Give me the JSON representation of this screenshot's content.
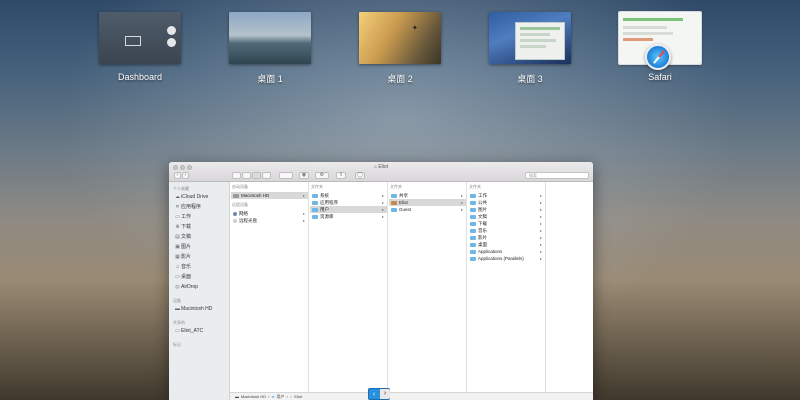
{
  "spaces": [
    {
      "label": "Dashboard"
    },
    {
      "label": "桌面 1"
    },
    {
      "label": "桌面 2"
    },
    {
      "label": "桌面 3"
    },
    {
      "label": "Safari"
    }
  ],
  "window": {
    "title": "Eliot",
    "search_placeholder": "搜索"
  },
  "sidebar": {
    "sections": [
      {
        "header": "个人收藏",
        "items": [
          {
            "label": "iCloud Drive",
            "icon": "cloud-icon"
          },
          {
            "label": "应用程序",
            "icon": "applications-icon"
          },
          {
            "label": "工作",
            "icon": "folder-icon"
          },
          {
            "label": "下载",
            "icon": "download-icon"
          },
          {
            "label": "文稿",
            "icon": "document-icon"
          },
          {
            "label": "图片",
            "icon": "image-icon"
          },
          {
            "label": "影片",
            "icon": "movie-icon"
          },
          {
            "label": "音乐",
            "icon": "music-icon"
          },
          {
            "label": "桌面",
            "icon": "desktop-icon"
          },
          {
            "label": "AirDrop",
            "icon": "airdrop-icon"
          }
        ]
      },
      {
        "header": "设备",
        "items": [
          {
            "label": "Macintosh HD",
            "icon": "harddisk-icon"
          }
        ]
      },
      {
        "header": "共享的",
        "items": [
          {
            "label": "Eliot_ATC",
            "icon": "computer-icon"
          }
        ]
      },
      {
        "header": "标记",
        "items": []
      }
    ]
  },
  "columns": [
    {
      "header": "启动设备",
      "rows": [
        {
          "label": "Macintosh HD",
          "selected": true,
          "arrow": true,
          "icon": "hd"
        }
      ],
      "subheader": "远程设备",
      "subrows": [
        {
          "label": "网络",
          "arrow": true
        },
        {
          "label": "远程光盘",
          "arrow": true
        }
      ]
    },
    {
      "header": "文件夹",
      "rows": [
        {
          "label": "系统",
          "arrow": true
        },
        {
          "label": "应用程序",
          "arrow": true
        },
        {
          "label": "用户",
          "arrow": true,
          "selected": true
        },
        {
          "label": "资源库",
          "arrow": true
        }
      ]
    },
    {
      "header": "文件夹",
      "rows": [
        {
          "label": "共享",
          "arrow": true
        },
        {
          "label": "Eliot",
          "arrow": true,
          "selected": true
        },
        {
          "label": "Guest",
          "arrow": true
        }
      ]
    },
    {
      "header": "文件夹",
      "rows": [
        {
          "label": "工作",
          "arrow": true
        },
        {
          "label": "公共",
          "arrow": true
        },
        {
          "label": "图片",
          "arrow": true
        },
        {
          "label": "文稿",
          "arrow": true
        },
        {
          "label": "下载",
          "arrow": true
        },
        {
          "label": "音乐",
          "arrow": true
        },
        {
          "label": "影片",
          "arrow": true
        },
        {
          "label": "桌面",
          "arrow": true
        },
        {
          "label": "Applications",
          "arrow": true
        },
        {
          "label": "Applications (Parallels)",
          "arrow": true
        }
      ]
    }
  ],
  "pathbar": {
    "items": [
      "Macintosh HD",
      "用户",
      "Eliot"
    ],
    "separator": "›"
  },
  "nav": {
    "back": "‹",
    "forward": "›"
  },
  "toolbar": {
    "back": "‹",
    "forward": "›",
    "gear": "⚙",
    "eye": "◉",
    "share": "⇧",
    "tag": "◯"
  }
}
